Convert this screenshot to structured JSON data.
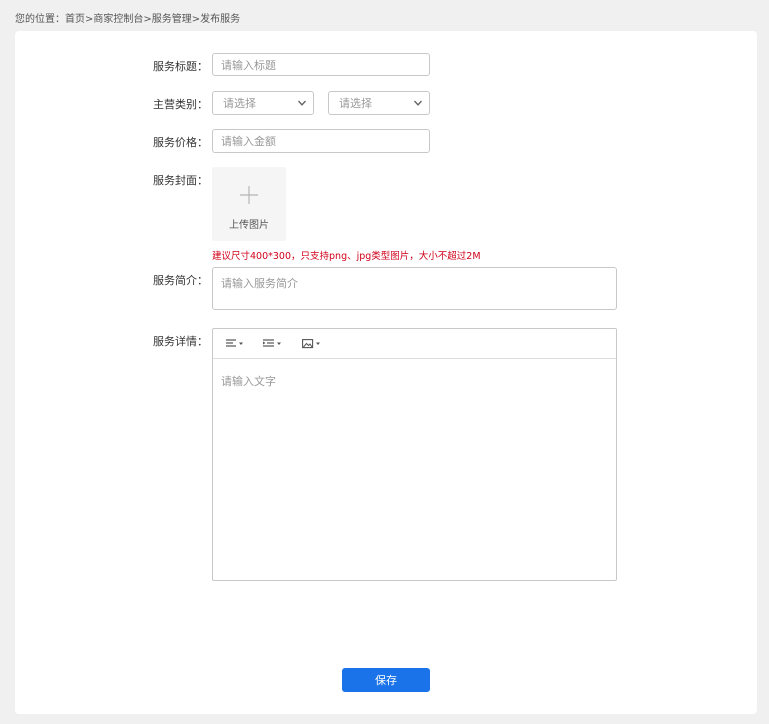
{
  "breadcrumb": {
    "prefix": "您的位置：",
    "items": [
      "首页",
      "商家控制台",
      "服务管理",
      "发布服务"
    ],
    "separator": ">"
  },
  "form": {
    "title": {
      "label": "服务标题：",
      "placeholder": "请输入标题"
    },
    "category": {
      "label": "主营类别：",
      "select1": "请选择",
      "select2": "请选择"
    },
    "price": {
      "label": "服务价格：",
      "placeholder": "请输入金额"
    },
    "cover": {
      "label": "服务封面：",
      "upload_text": "上传图片",
      "hint": "建议尺寸400*300，只支持png、jpg类型图片，大小不超过2M"
    },
    "summary": {
      "label": "服务简介：",
      "placeholder": "请输入服务简介"
    },
    "detail": {
      "label": "服务详情：",
      "placeholder": "请输入文字",
      "toolbar": [
        "align-icon",
        "indent-icon",
        "image-icon"
      ]
    },
    "save_label": "保存"
  },
  "colors": {
    "accent": "#1a73e8",
    "hint": "#d0021b",
    "page_bg": "#f1f0f1"
  }
}
